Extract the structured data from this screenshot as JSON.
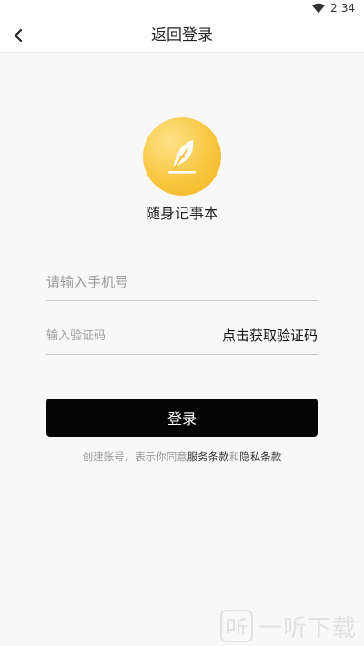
{
  "status_bar": {
    "time": "2:34",
    "wifi_icon": "wifi-icon"
  },
  "header": {
    "title": "返回登录",
    "back_icon": "chevron-left-icon"
  },
  "app": {
    "name": "随身记事本",
    "logo_icon": "feather-pen-icon",
    "logo_color": "#f9c640"
  },
  "form": {
    "phone_placeholder": "请输入手机号",
    "phone_value": "",
    "code_placeholder": "输入验证码",
    "code_value": "",
    "get_code_label": "点击获取验证码",
    "login_label": "登录"
  },
  "agreement": {
    "prefix": "创建账号，表示你同意",
    "terms": "服务条款",
    "and": "和",
    "privacy": "隐私条款"
  },
  "watermark": {
    "text": "一听下载"
  }
}
